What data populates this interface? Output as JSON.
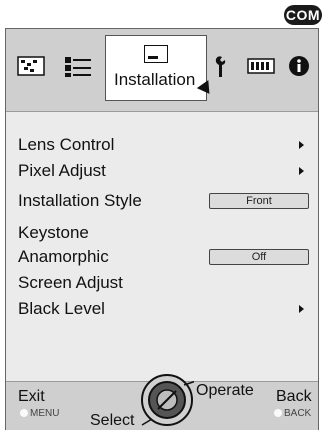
{
  "badge": "COM",
  "tabs": {
    "active_label": "Installation"
  },
  "menu": {
    "items": [
      {
        "label": "Lens Control",
        "arrow": true
      },
      {
        "label": "Pixel Adjust",
        "arrow": true
      },
      {
        "label": "Installation Style",
        "value": "Front"
      },
      {
        "label": "Keystone"
      },
      {
        "label": "Anamorphic",
        "value": "Off"
      },
      {
        "label": "Screen Adjust"
      },
      {
        "label": "Black Level",
        "arrow": true
      }
    ]
  },
  "footer": {
    "exit": "Exit",
    "exit_hint": "MENU",
    "select": "Select",
    "operate": "Operate",
    "back": "Back",
    "back_hint": "BACK"
  },
  "colors": {
    "tabbar_bg": "#cfcfcf",
    "menu_bg": "#ebebeb",
    "value_box_bg": "#dcdcdc"
  }
}
